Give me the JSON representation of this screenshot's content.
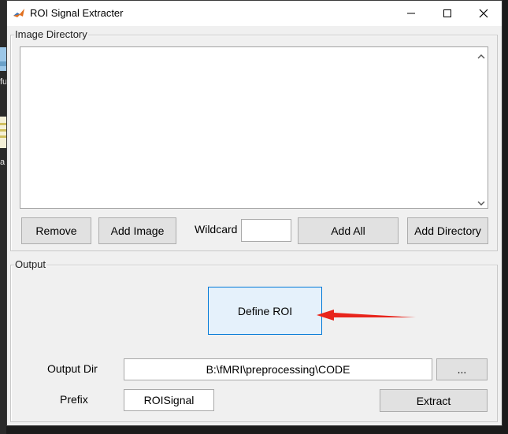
{
  "desktop": {
    "fragments": [
      "fu",
      "a"
    ]
  },
  "window": {
    "title": "ROI Signal Extracter",
    "icon": "matlab-icon",
    "controls": [
      "minimize-icon",
      "maximize-icon",
      "close-icon"
    ]
  },
  "image_panel": {
    "title": "Image Directory",
    "list_items": [],
    "buttons": {
      "remove": "Remove",
      "add_image": "Add Image",
      "add_all": "Add All",
      "add_directory": "Add Directory"
    },
    "wildcard_label": "Wildcard",
    "wildcard_value": ""
  },
  "output_panel": {
    "title": "Output",
    "define_roi_label": "Define ROI",
    "output_dir_label": "Output Dir",
    "output_dir_value": "B:\\fMRI\\preprocessing\\CODE",
    "browse_label": "...",
    "prefix_label": "Prefix",
    "prefix_value": "ROISignal",
    "extract_label": "Extract"
  },
  "annotation": {
    "arrow_color": "#e8251c"
  },
  "colors": {
    "accent_border": "#0078d7",
    "accent_fill": "#e5f1fb"
  }
}
